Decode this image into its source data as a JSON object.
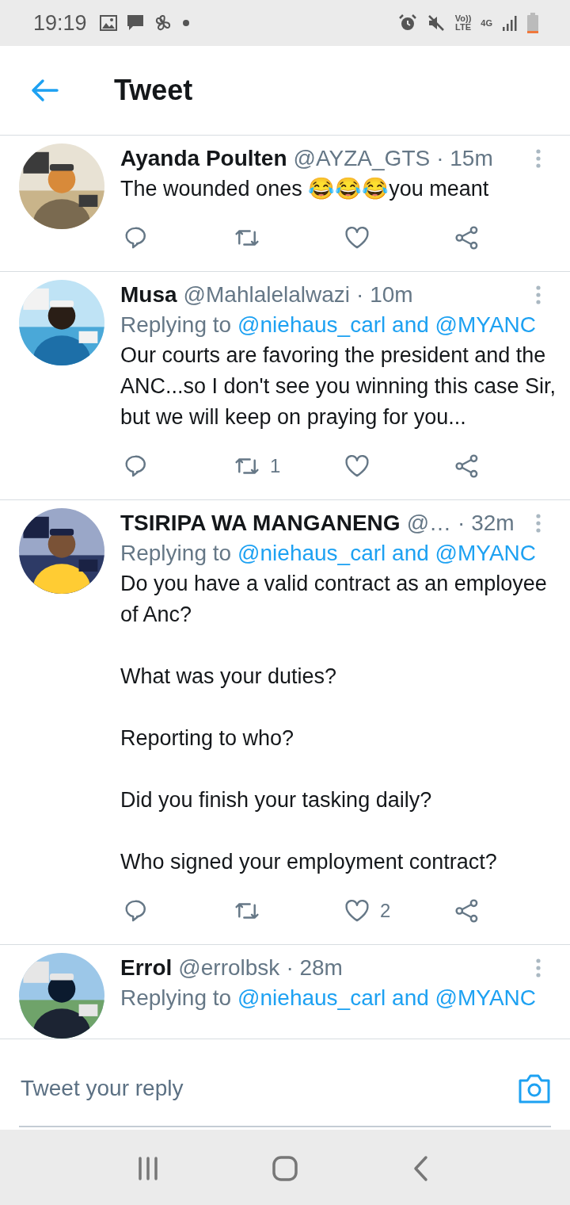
{
  "status_bar": {
    "time": "19:19",
    "volte_top": "Vo))",
    "volte_bottom": "LTE",
    "network": "4G"
  },
  "header": {
    "title": "Tweet"
  },
  "tweets": [
    {
      "name": "Ayanda Poulten",
      "handle": "@AYZA_GTS",
      "time": "· 15m",
      "body": [
        "The wounded ones 😂😂😂you meant"
      ]
    },
    {
      "name": "Musa",
      "handle": "@Mahlalelalwazi",
      "time": "· 10m",
      "replying_label": "Replying to",
      "mentions": "@niehaus_carl and @MYANC",
      "body": [
        "Our courts are favoring the president and the ANC...so I don't see you winning this case Sir, but we will keep on praying for you..."
      ],
      "retweet_count": "1"
    },
    {
      "name": "TSIRIPA WA MANGANENG",
      "handle": "@…",
      "time": "· 32m",
      "replying_label": "Replying to",
      "mentions": "@niehaus_carl and @MYANC",
      "body": [
        "Do you have a valid contract as an employee of Anc?",
        "What was your duties?",
        "Reporting to who?",
        "Did you finish your tasking daily?",
        "Who signed your employment contract?"
      ],
      "like_count": "2"
    },
    {
      "name": "Errol",
      "handle": "@errolbsk",
      "time": "· 28m",
      "replying_label": "Replying to",
      "mentions": "@niehaus_carl and @MYANC"
    }
  ],
  "reply_bar": {
    "placeholder": "Tweet your reply"
  }
}
